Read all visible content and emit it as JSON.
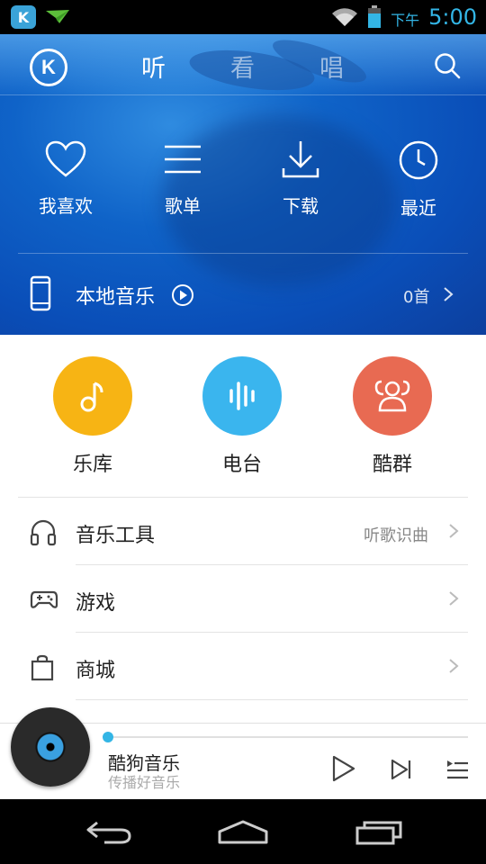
{
  "status_bar": {
    "app_badge": "K",
    "ampm": "下午",
    "time": "5:00",
    "accent_color": "#33b5e5"
  },
  "top_bar": {
    "logo_letter": "K",
    "tabs": [
      "听",
      "看",
      "唱"
    ],
    "active_tab": "听",
    "search_icon": "search-icon"
  },
  "quick_actions": [
    {
      "label": "我喜欢",
      "icon": "heart-icon"
    },
    {
      "label": "歌单",
      "icon": "list-icon"
    },
    {
      "label": "下载",
      "icon": "download-icon"
    },
    {
      "label": "最近",
      "icon": "clock-icon"
    }
  ],
  "local_music": {
    "label": "本地音乐",
    "count": "0首",
    "icon": "phone-icon"
  },
  "features": [
    {
      "label": "乐库",
      "icon": "music-note-icon",
      "color": "#f7b414"
    },
    {
      "label": "电台",
      "icon": "radio-bars-icon",
      "color": "#3ab5ee"
    },
    {
      "label": "酷群",
      "icon": "group-icon",
      "color": "#e86a52"
    }
  ],
  "menu": [
    {
      "label": "音乐工具",
      "right": "听歌识曲",
      "icon": "headphones-icon"
    },
    {
      "label": "游戏",
      "right": "",
      "icon": "gamepad-icon"
    },
    {
      "label": "商城",
      "right": "",
      "icon": "shopping-bag-icon"
    }
  ],
  "player": {
    "title": "酷狗音乐",
    "subtitle": "传播好音乐",
    "progress": 0.0
  }
}
